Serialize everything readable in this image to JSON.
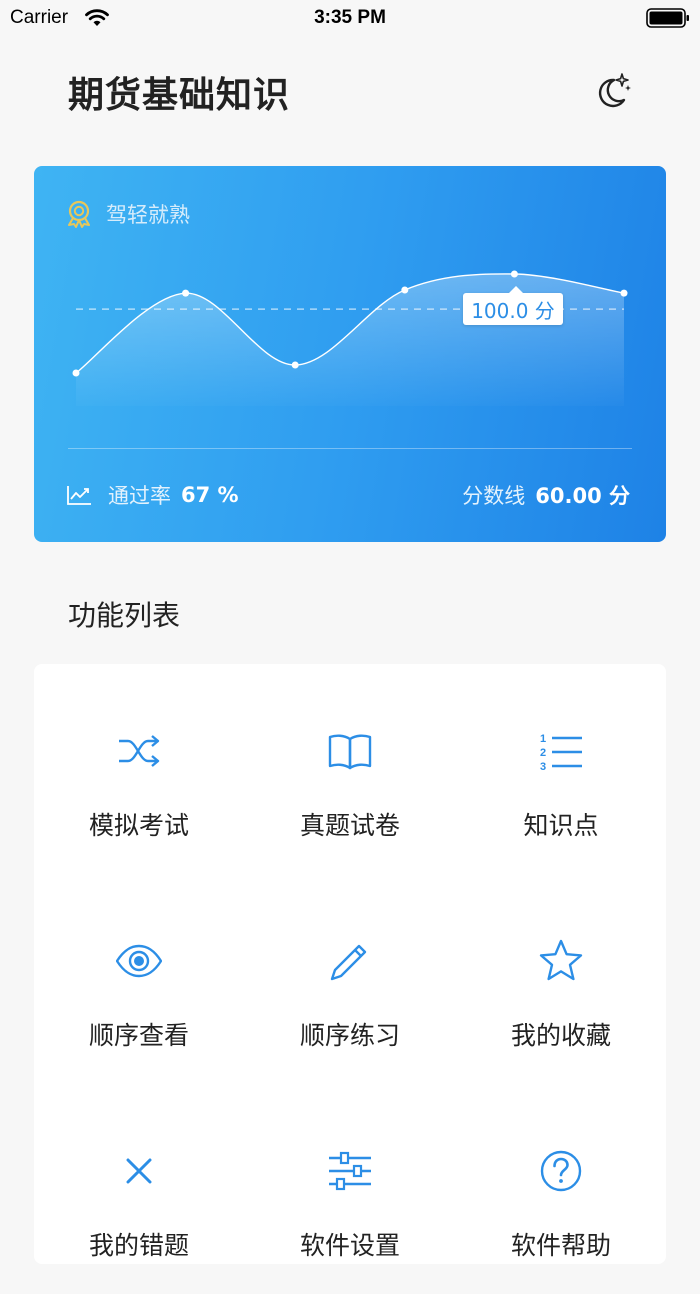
{
  "status_bar": {
    "carrier": "Carrier",
    "time": "3:35 PM"
  },
  "header": {
    "title": "期货基础知识",
    "theme_icon": "moon-sparkle-icon"
  },
  "score_card": {
    "level": "驾轻就熟",
    "level_icon": "award-badge-icon",
    "tooltip": "100.0 分",
    "pass_rate_label": "通过率",
    "pass_rate_value": "67 %",
    "score_line_label": "分数线",
    "score_line_value": "60.00 分",
    "gradient": [
      "#3fb4f3",
      "#1e82e6"
    ]
  },
  "chart_data": {
    "type": "area",
    "values": [
      40,
      90,
      45,
      92,
      102,
      90
    ],
    "reference_line": 80,
    "ylim": [
      0,
      110
    ]
  },
  "functions": {
    "title": "功能列表",
    "accent": "#2c8ee6",
    "items": [
      {
        "label": "模拟考试",
        "icon": "shuffle-icon"
      },
      {
        "label": "真题试卷",
        "icon": "book-icon"
      },
      {
        "label": "知识点",
        "icon": "numbered-list-icon"
      },
      {
        "label": "顺序查看",
        "icon": "eye-icon"
      },
      {
        "label": "顺序练习",
        "icon": "pencil-icon"
      },
      {
        "label": "我的收藏",
        "icon": "star-icon"
      },
      {
        "label": "我的错题",
        "icon": "close-icon"
      },
      {
        "label": "软件设置",
        "icon": "sliders-icon"
      },
      {
        "label": "软件帮助",
        "icon": "help-circle-icon"
      }
    ]
  }
}
